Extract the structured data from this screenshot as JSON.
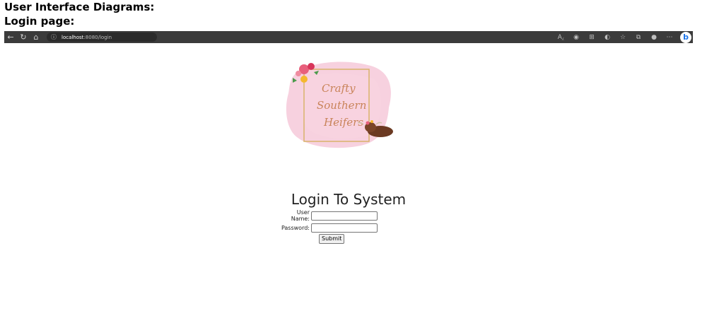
{
  "doc": {
    "heading": "User Interface Diagrams:",
    "subheading": "Login page:"
  },
  "browser": {
    "back_icon": "back-arrow-icon",
    "refresh_icon": "refresh-icon",
    "home_icon": "home-icon",
    "info_icon": "info-icon",
    "url_host": "localhost",
    "url_path": ":8080/login",
    "toolbar_icons": [
      "read-aloud-icon",
      "tracking-prevention-icon",
      "extensions-icon",
      "browser-essentials-icon",
      "favorites-star-icon",
      "collections-icon",
      "profile-icon",
      "more-icon",
      "bing-icon"
    ]
  },
  "logo": {
    "line1": "Crafty",
    "line2": "Southern",
    "line3": "Heifers"
  },
  "login": {
    "title": "Login To System",
    "username_label": "User Name:",
    "username_value": "",
    "password_label": "Password:",
    "password_value": "",
    "submit_label": "Submit"
  },
  "colors": {
    "browser_bar": "#3b3b3b",
    "logo_pink": "#f4c2d4",
    "logo_gold": "#d9b36a",
    "logo_text": "#c9845a"
  }
}
